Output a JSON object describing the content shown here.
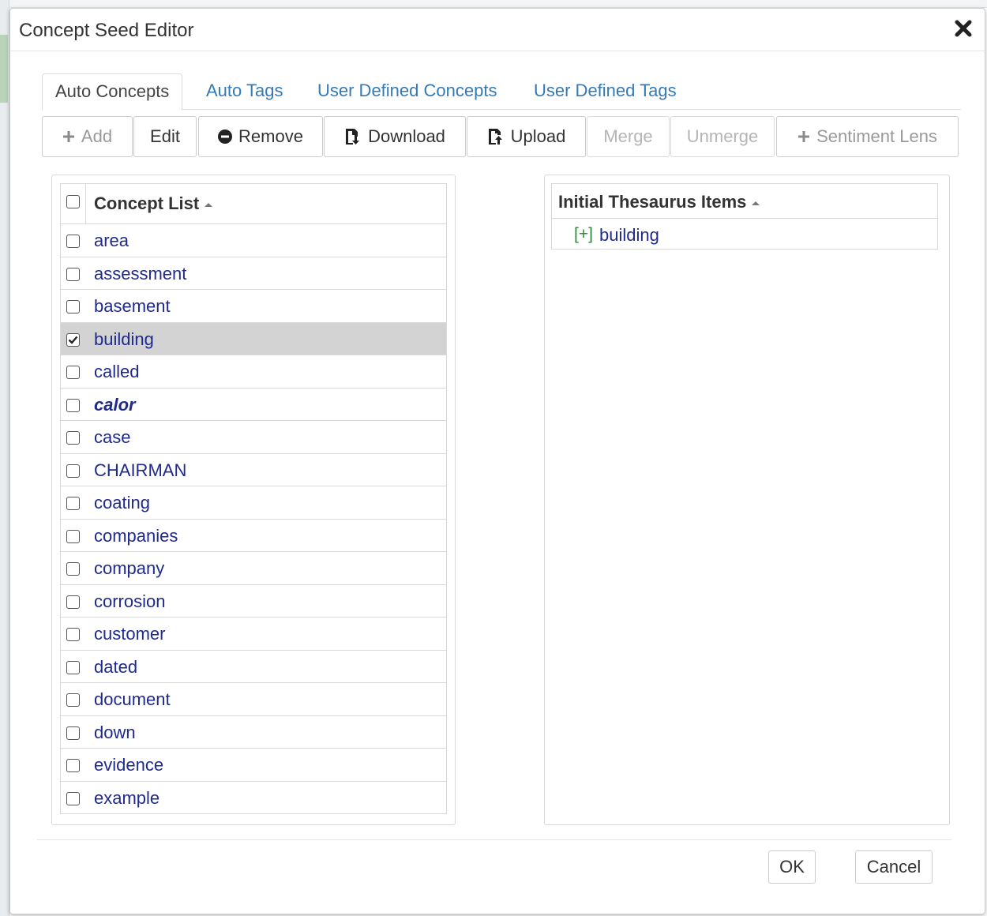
{
  "dialog": {
    "title": "Concept Seed Editor"
  },
  "tabs": [
    {
      "label": "Auto Concepts",
      "active": true
    },
    {
      "label": "Auto Tags",
      "active": false
    },
    {
      "label": "User Defined Concepts",
      "active": false
    },
    {
      "label": "User Defined Tags",
      "active": false
    }
  ],
  "toolbar": {
    "add": "Add",
    "edit": "Edit",
    "remove": "Remove",
    "download": "Download",
    "upload": "Upload",
    "merge": "Merge",
    "unmerge": "Unmerge",
    "sentiment_lens": "Sentiment Lens"
  },
  "concept_list": {
    "header": "Concept List",
    "items": [
      {
        "term": "area",
        "checked": false,
        "emphasis": false
      },
      {
        "term": "assessment",
        "checked": false,
        "emphasis": false
      },
      {
        "term": "basement",
        "checked": false,
        "emphasis": false
      },
      {
        "term": "building",
        "checked": true,
        "emphasis": false
      },
      {
        "term": "called",
        "checked": false,
        "emphasis": false
      },
      {
        "term": "calor",
        "checked": false,
        "emphasis": true
      },
      {
        "term": "case",
        "checked": false,
        "emphasis": false
      },
      {
        "term": "CHAIRMAN",
        "checked": false,
        "emphasis": false
      },
      {
        "term": "coating",
        "checked": false,
        "emphasis": false
      },
      {
        "term": "companies",
        "checked": false,
        "emphasis": false
      },
      {
        "term": "company",
        "checked": false,
        "emphasis": false
      },
      {
        "term": "corrosion",
        "checked": false,
        "emphasis": false
      },
      {
        "term": "customer",
        "checked": false,
        "emphasis": false
      },
      {
        "term": "dated",
        "checked": false,
        "emphasis": false
      },
      {
        "term": "document",
        "checked": false,
        "emphasis": false
      },
      {
        "term": "down",
        "checked": false,
        "emphasis": false
      },
      {
        "term": "evidence",
        "checked": false,
        "emphasis": false
      },
      {
        "term": "example",
        "checked": false,
        "emphasis": false
      }
    ]
  },
  "thesaurus": {
    "header": "Initial Thesaurus Items",
    "items": [
      {
        "expander": "[+]",
        "term": "building"
      }
    ]
  },
  "footer": {
    "ok": "OK",
    "cancel": "Cancel"
  },
  "colors": {
    "link": "#337ab7",
    "term": "#1f2a8c",
    "expander": "#2e8b3a",
    "selected_row": "#d3d3d3"
  }
}
